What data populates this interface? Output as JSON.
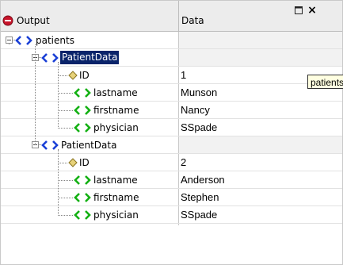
{
  "header": {
    "output_label": "Output",
    "data_label": "Data"
  },
  "icons": {
    "output": "minus-circle-icon",
    "element": "xml-element-icon",
    "attribute": "xml-attribute-icon",
    "restore": "restore-window-icon",
    "close": "close-icon"
  },
  "colors": {
    "element_icon_blue": "#1a3fd6",
    "child_icon_green": "#13b013",
    "attribute_icon": "#e7d27a",
    "selection": "#0a246a",
    "output_icon_red": "#c8142a"
  },
  "tree": {
    "root_label": "patients",
    "groups": [
      {
        "label": "PatientData",
        "selected": true,
        "fields": [
          {
            "name": "ID",
            "value": "1"
          },
          {
            "name": "lastname",
            "value": "Munson"
          },
          {
            "name": "firstname",
            "value": "Nancy"
          },
          {
            "name": "physician",
            "value": "SSpade"
          }
        ]
      },
      {
        "label": "PatientData",
        "selected": false,
        "fields": [
          {
            "name": "ID",
            "value": "2"
          },
          {
            "name": "lastname",
            "value": "Anderson"
          },
          {
            "name": "firstname",
            "value": "Stephen"
          },
          {
            "name": "physician",
            "value": "SSpade"
          }
        ]
      }
    ]
  },
  "tooltip": {
    "text": "patients"
  }
}
